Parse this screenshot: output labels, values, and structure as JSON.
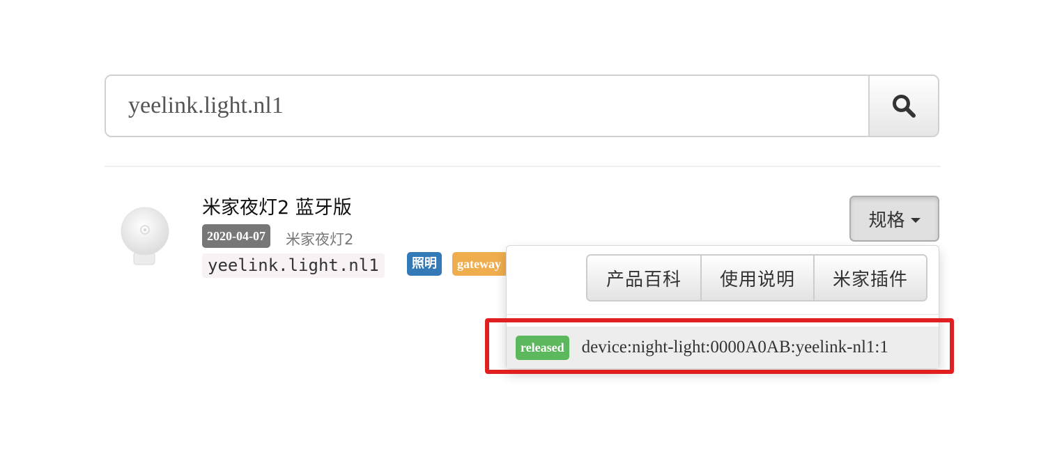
{
  "search": {
    "value": "yeelink.light.nl1",
    "button_icon": "search-icon"
  },
  "product": {
    "image_icon": "night-light-image",
    "title": "米家夜灯2 蓝牙版",
    "release_date": "2020-04-07",
    "subname": "米家夜灯2",
    "model": "yeelink.light.nl1",
    "tags": [
      "照明",
      "gateway"
    ],
    "tag_colors": {
      "lighting": "#337ab7",
      "gateway": "#f0ad4e"
    }
  },
  "spec_dropdown": {
    "label": "规格",
    "caret_icon": "caret-down-icon",
    "buttons": [
      "产品百科",
      "使用说明",
      "米家插件"
    ],
    "urn_status": "released",
    "urn": "device:night-light:0000A0AB:yeelink-nl1:1",
    "status_color": "#5cb85c"
  },
  "highlight_color": "#e02020"
}
